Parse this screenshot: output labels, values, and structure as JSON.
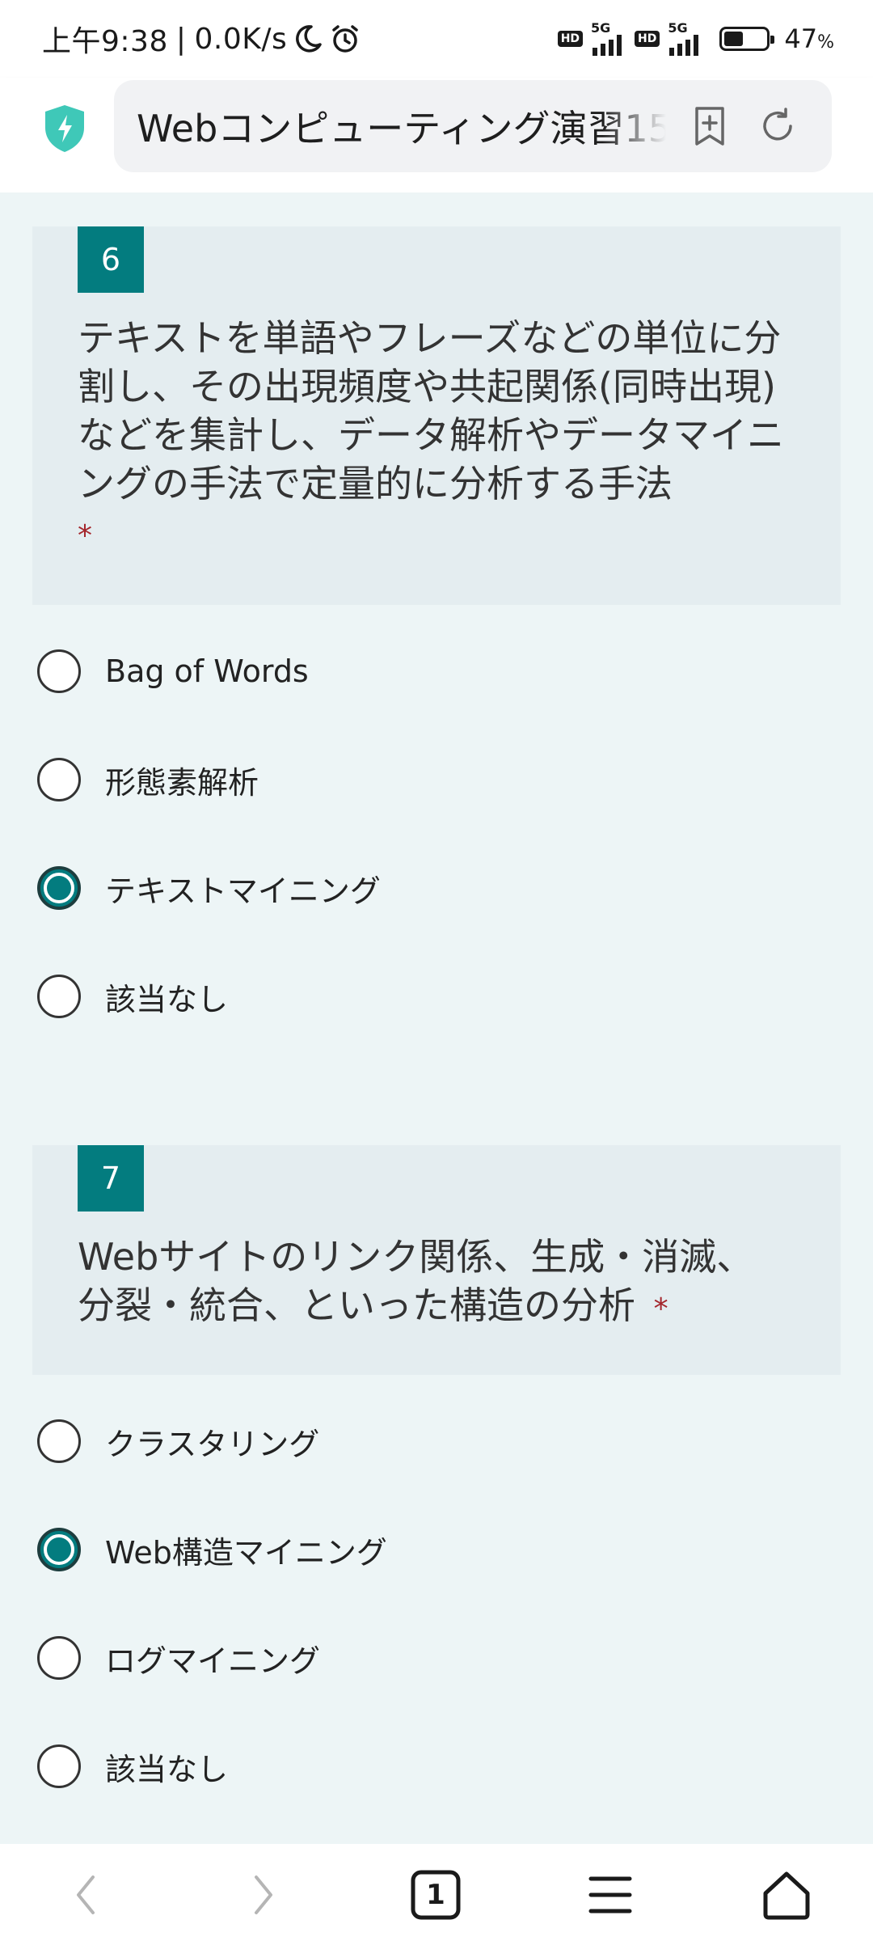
{
  "status_bar": {
    "time": "上午9:38",
    "separator": "|",
    "speed": "0.0K/s",
    "hd1": "HD",
    "net1": "5G",
    "hd2": "HD",
    "net2": "5G",
    "battery_percent": "47",
    "percent_sign": "%"
  },
  "browser": {
    "url_title": "Webコンピューティング演習15",
    "tab_count": "1"
  },
  "questions": [
    {
      "number": "6",
      "text": "テキストを単語やフレーズなどの単位に分割し、その出現頻度や共起関係(同時出現)などを集計し、データ解析やデータマイニングの手法で定量的に分析する手法",
      "required_mark": "*",
      "options": [
        {
          "label": "Bag of Words",
          "selected": false
        },
        {
          "label": "形態素解析",
          "selected": false
        },
        {
          "label": "テキストマイニング",
          "selected": true
        },
        {
          "label": "該当なし",
          "selected": false
        }
      ]
    },
    {
      "number": "7",
      "text": "Webサイトのリンク関係、生成・消滅、分裂・統合、といった構造の分析",
      "required_mark": "*",
      "options": [
        {
          "label": "クラスタリング",
          "selected": false
        },
        {
          "label": "Web構造マイニング",
          "selected": true
        },
        {
          "label": "ログマイニング",
          "selected": false
        },
        {
          "label": "該当なし",
          "selected": false
        }
      ]
    }
  ],
  "colors": {
    "accent": "#037c7f",
    "required": "#a4262c",
    "page_bg": "#edf5f6",
    "card_bg": "#e4edf0"
  }
}
